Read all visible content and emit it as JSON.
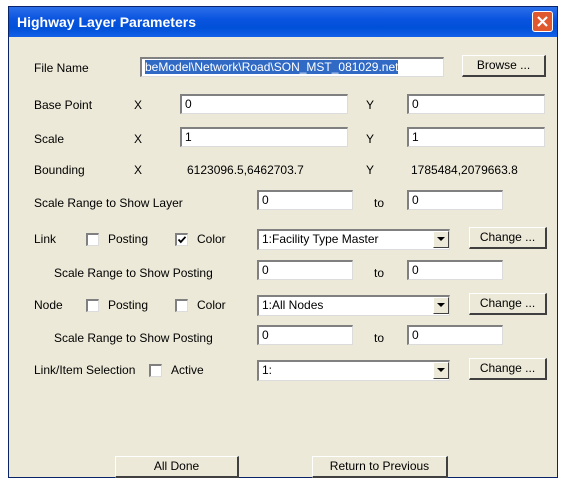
{
  "window": {
    "title": "Highway Layer Parameters"
  },
  "file": {
    "label": "File Name",
    "value": "beModel\\Network\\Road\\SON_MST_081029.net",
    "browse": "Browse ..."
  },
  "base_point": {
    "label": "Base Point",
    "x_label": "X",
    "x": "0",
    "y_label": "Y",
    "y": "0"
  },
  "scale": {
    "label": "Scale",
    "x_label": "X",
    "x": "1",
    "y_label": "Y",
    "y": "1"
  },
  "bounding": {
    "label": "Bounding",
    "x_label": "X",
    "x": "6123096.5,6462703.7",
    "y_label": "Y",
    "y": "1785484,2079663.8"
  },
  "scale_range": {
    "label": "Scale Range to Show Layer",
    "from": "0",
    "to_label": "to",
    "to": "0"
  },
  "link": {
    "label": "Link",
    "posting_label": "Posting",
    "posting_checked": false,
    "color_label": "Color",
    "color_checked": true,
    "select": "1:Facility Type Master",
    "change": "Change ...",
    "range_label": "Scale Range to Show Posting",
    "from": "0",
    "to_label": "to",
    "to": "0"
  },
  "node": {
    "label": "Node",
    "posting_label": "Posting",
    "posting_checked": false,
    "color_label": "Color",
    "color_checked": false,
    "select": "1:All Nodes",
    "change": "Change ...",
    "range_label": "Scale Range to Show Posting",
    "from": "0",
    "to_label": "to",
    "to": "0"
  },
  "selection": {
    "label": "Link/Item Selection",
    "active_label": "Active",
    "active_checked": false,
    "select": "1:",
    "change": "Change ..."
  },
  "footer": {
    "all_done": "All Done",
    "return": "Return to Previous"
  }
}
